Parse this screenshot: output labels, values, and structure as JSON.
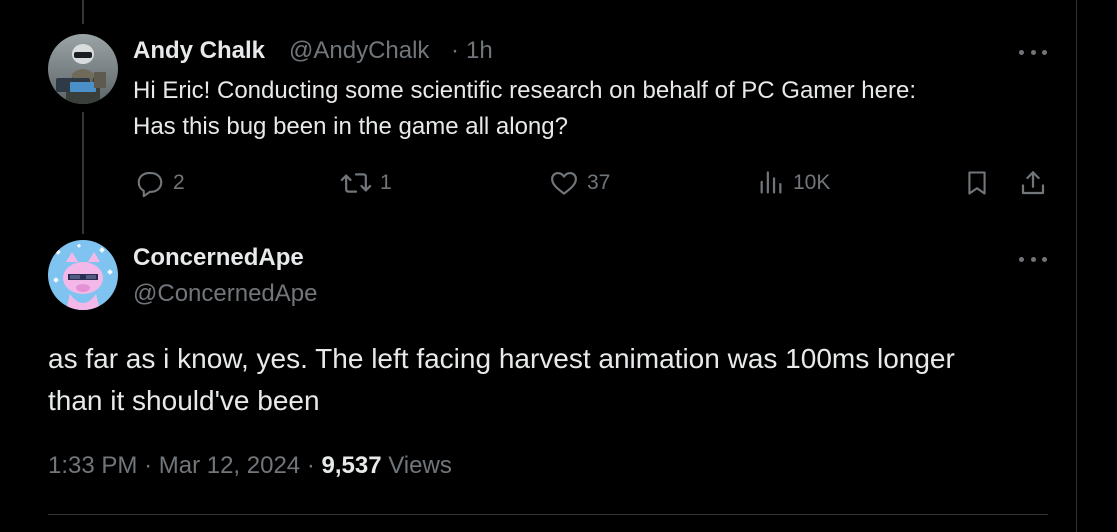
{
  "parent_tweet": {
    "author_name": "Andy Chalk",
    "author_handle": "@AndyChalk",
    "separator": "·",
    "time_ago": "1h",
    "text_line_1": "Hi Eric! Conducting some scientific research on behalf of PC Gamer here:",
    "text_line_2": "Has this bug been in the game all along?",
    "actions": {
      "replies": "2",
      "reposts": "1",
      "likes": "37",
      "views": "10K"
    }
  },
  "reply_tweet": {
    "author_name": "ConcernedApe",
    "author_handle": "@ConcernedApe",
    "text_line_1": "as far as i know, yes. The left facing harvest animation was 100ms longer",
    "text_line_2": "than it should've been",
    "time": "1:33 PM",
    "separator_1": "·",
    "date": "Mar 12, 2024",
    "separator_2": "·",
    "views_count": "9,537",
    "views_label": "Views"
  },
  "icons": {
    "reply": "reply-icon",
    "repost": "repost-icon",
    "like": "heart-icon",
    "views": "analytics-icon",
    "bookmark": "bookmark-icon",
    "share": "share-icon",
    "more": "more-icon"
  },
  "colors": {
    "background": "#000000",
    "text_primary": "#e7e9ea",
    "text_secondary": "#71767b",
    "thread_line": "#333639"
  }
}
